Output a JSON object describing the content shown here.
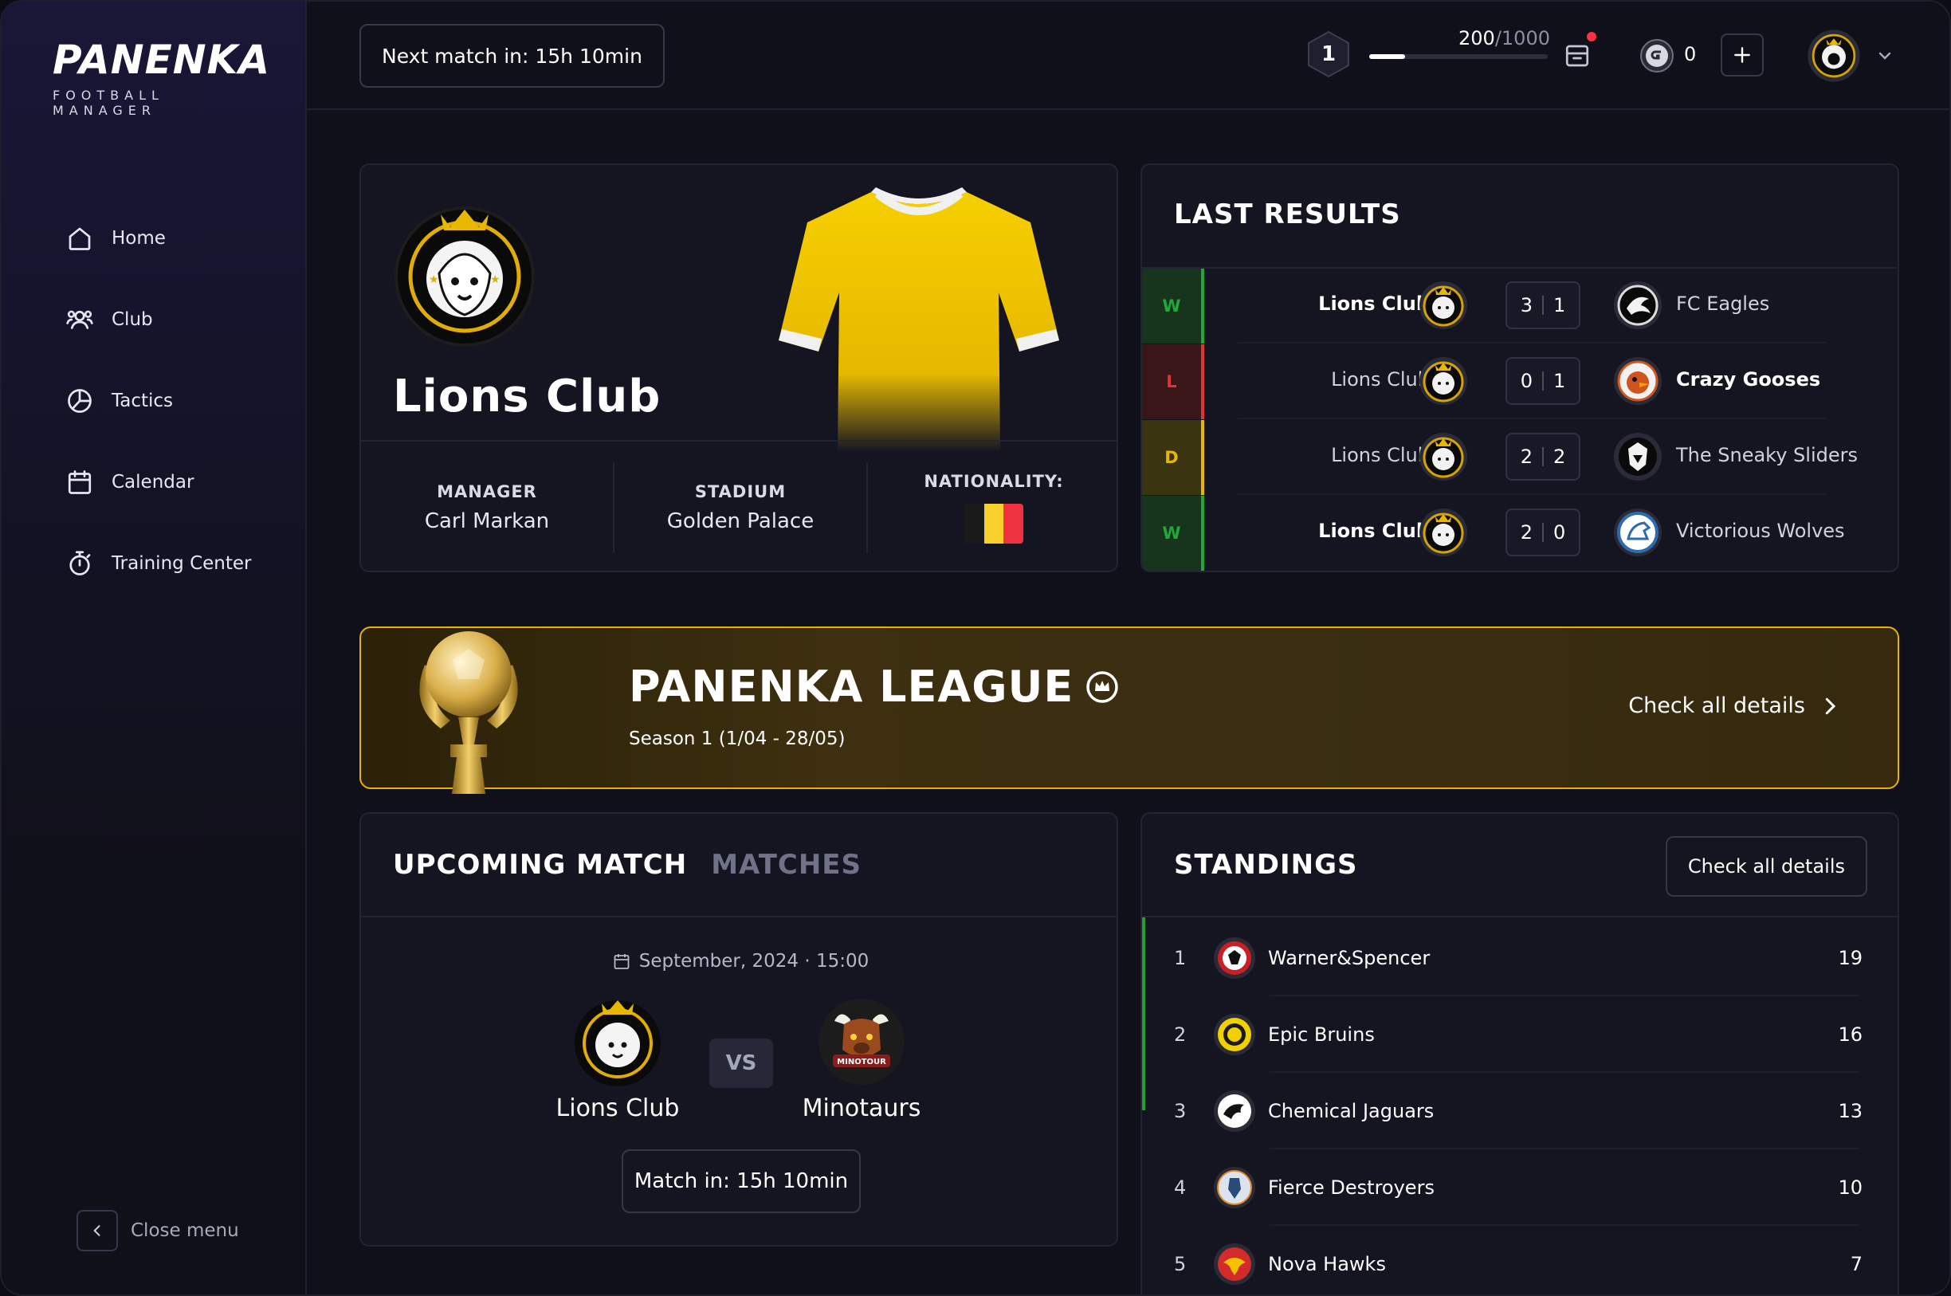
{
  "brand": {
    "title": "PANENKA",
    "subtitle": "FOOTBALL MANAGER"
  },
  "sidebar": {
    "items": [
      {
        "label": "Home",
        "icon": "home-icon"
      },
      {
        "label": "Club",
        "icon": "users-icon"
      },
      {
        "label": "Tactics",
        "icon": "pie-chart-icon"
      },
      {
        "label": "Calendar",
        "icon": "calendar-icon"
      },
      {
        "label": "Training Center",
        "icon": "stopwatch-icon"
      }
    ],
    "close_label": "Close menu"
  },
  "topbar": {
    "next_match": "Next match in: 15h 10min",
    "level": "1",
    "xp_current": "200",
    "xp_max": "/1000",
    "xp_progress": 0.2,
    "coins": "0"
  },
  "club": {
    "name": "Lions Club",
    "manager_label": "MANAGER",
    "manager": "Carl Markan",
    "stadium_label": "STADIUM",
    "stadium": "Golden Palace",
    "nationality_label": "NATIONALITY:",
    "flag_colors": [
      "#1a1a1a",
      "#f7d02b",
      "#ef3340"
    ],
    "jersey_color": "#f4c400"
  },
  "last_results": {
    "title": "LAST RESULTS",
    "rows": [
      {
        "result": "W",
        "home": "Lions Club",
        "home_score": "3",
        "away_score": "1",
        "away": "FC Eagles",
        "winner": "home"
      },
      {
        "result": "L",
        "home": "Lions Club",
        "home_score": "0",
        "away_score": "1",
        "away": "Crazy Gooses",
        "winner": "away"
      },
      {
        "result": "D",
        "home": "Lions Club",
        "home_score": "2",
        "away_score": "2",
        "away": "The Sneaky Sliders",
        "winner": "none"
      },
      {
        "result": "W",
        "home": "Lions Club",
        "home_score": "2",
        "away_score": "0",
        "away": "Victorious Wolves",
        "winner": "home"
      }
    ]
  },
  "league": {
    "title": "PANENKA LEAGUE",
    "season": "Season 1 (1/04 - 28/05)",
    "link": "Check all details"
  },
  "upcoming": {
    "tab_active": "UPCOMING MATCH",
    "tab_inactive": "MATCHES",
    "date": "September, 2024 · 15:00",
    "team_a": "Lions Club",
    "vs": "VS",
    "team_b": "Minotaurs",
    "team_b_badge": "MINOTOUR",
    "match_in": "Match in: 15h 10min"
  },
  "standings": {
    "title": "STANDINGS",
    "button": "Check all details",
    "rows": [
      {
        "pos": "1",
        "team": "Warner&Spencer",
        "pts": "19"
      },
      {
        "pos": "2",
        "team": "Epic Bruins",
        "pts": "16"
      },
      {
        "pos": "3",
        "team": "Chemical Jaguars",
        "pts": "13"
      },
      {
        "pos": "4",
        "team": "Fierce Destroyers",
        "pts": "10"
      },
      {
        "pos": "5",
        "team": "Nova Hawks",
        "pts": "7"
      }
    ]
  },
  "colors": {
    "win": "#22a83a",
    "loss": "#e0342f",
    "draw": "#e8b800",
    "accent_gold": "#e7b200"
  }
}
